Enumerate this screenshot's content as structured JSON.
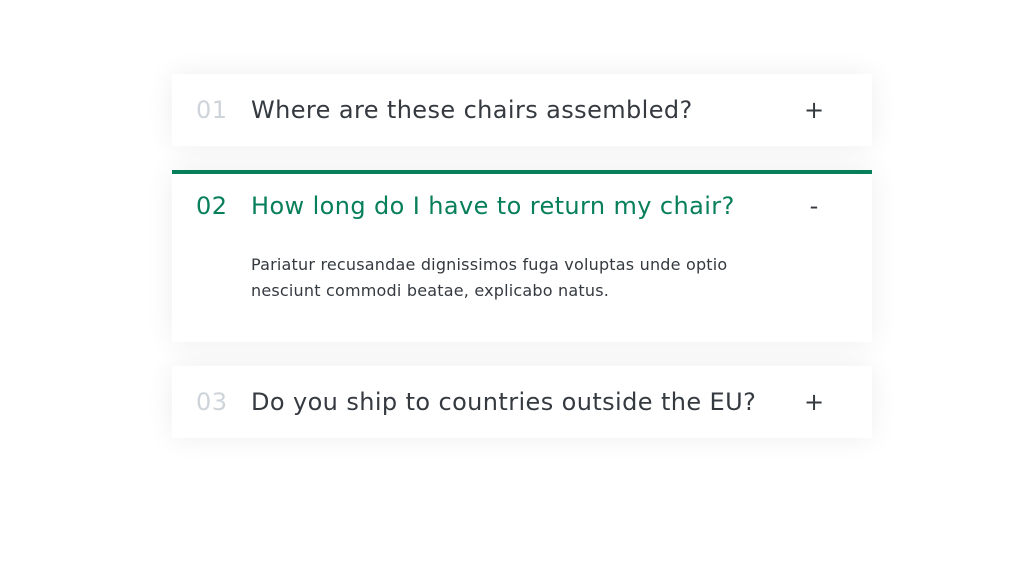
{
  "faq": {
    "items": [
      {
        "number": "01",
        "question": "Where are these chairs assembled?",
        "toggle": "+",
        "open": false
      },
      {
        "number": "02",
        "question": "How long do I have to return my chair?",
        "toggle": "-",
        "open": true,
        "answer": "Pariatur recusandae dignissimos fuga voluptas unde optio nesciunt commodi beatae, explicabo natus."
      },
      {
        "number": "03",
        "question": "Do you ship to countries outside the EU?",
        "toggle": "+",
        "open": false
      }
    ]
  },
  "colors": {
    "accent": "#087f5b",
    "text": "#343a40",
    "muted_number": "#ced4da"
  }
}
